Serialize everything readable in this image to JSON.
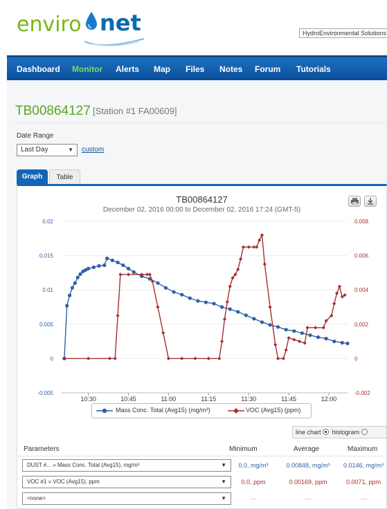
{
  "brand": {
    "logo_left": "enviro",
    "logo_right": "net",
    "tagline": "HydroEnvironmental Solutions"
  },
  "nav": {
    "items": [
      "Dashboard",
      "Monitor",
      "Alerts",
      "Map",
      "Files",
      "Notes",
      "Forum",
      "Tutorials"
    ],
    "active": "Monitor"
  },
  "station": {
    "id": "TB00864127",
    "sub": "[Station #1 FA00609]"
  },
  "date_range": {
    "label": "Date Range",
    "selected": "Last Day",
    "custom_link": "custom"
  },
  "tabs": {
    "graph": "Graph",
    "table": "Table"
  },
  "colors": {
    "series1": "#2f5fa8",
    "series2": "#a33030",
    "accent": "#1565b4",
    "station_title": "#5aa520"
  },
  "chart_data": {
    "type": "line",
    "title": "TB00864127",
    "subtitle": "December 02, 2016 00:00 to December 02, 2016 17:24 (GMT-5)",
    "x_ticks": [
      "10:30",
      "10:45",
      "11:00",
      "11:15",
      "11:30",
      "11:45",
      "12:00"
    ],
    "xlim": [
      "10:20",
      "12:07"
    ],
    "y_left": {
      "ticks": [
        "-0.005",
        "0",
        "0.005",
        "0.01",
        "0.015",
        "0.02"
      ],
      "range": [
        -0.005,
        0.02
      ]
    },
    "y_right": {
      "ticks": [
        "-0.002",
        "0",
        "0.002",
        "0.004",
        "0.006",
        "0.008"
      ],
      "range": [
        -0.002,
        0.008
      ]
    },
    "legend_placement": "bottom",
    "series": [
      {
        "name": "Mass Conc. Total (Avg15) (mg/m³)",
        "axis": "left",
        "marker": "circle",
        "points": [
          [
            "10:21",
            0.0
          ],
          [
            "10:22",
            0.0077
          ],
          [
            "10:23",
            0.0092
          ],
          [
            "10:24",
            0.0103
          ],
          [
            "10:25",
            0.011
          ],
          [
            "10:26",
            0.0118
          ],
          [
            "10:27",
            0.0123
          ],
          [
            "10:28",
            0.0127
          ],
          [
            "10:29",
            0.0129
          ],
          [
            "10:30",
            0.0131
          ],
          [
            "10:32",
            0.0133
          ],
          [
            "10:34",
            0.0135
          ],
          [
            "10:36",
            0.0136
          ],
          [
            "10:37",
            0.0146
          ],
          [
            "10:39",
            0.0143
          ],
          [
            "10:41",
            0.014
          ],
          [
            "10:43",
            0.0136
          ],
          [
            "10:45",
            0.0131
          ],
          [
            "10:47",
            0.0126
          ],
          [
            "10:50",
            0.012
          ],
          [
            "10:53",
            0.0116
          ],
          [
            "10:56",
            0.011
          ],
          [
            "10:59",
            0.0103
          ],
          [
            "11:02",
            0.0097
          ],
          [
            "11:05",
            0.0093
          ],
          [
            "11:08",
            0.0088
          ],
          [
            "11:11",
            0.0084
          ],
          [
            "11:14",
            0.0082
          ],
          [
            "11:17",
            0.008
          ],
          [
            "11:20",
            0.0075
          ],
          [
            "11:23",
            0.0072
          ],
          [
            "11:26",
            0.0068
          ],
          [
            "11:29",
            0.0063
          ],
          [
            "11:32",
            0.0058
          ],
          [
            "11:35",
            0.0053
          ],
          [
            "11:38",
            0.0049
          ],
          [
            "11:41",
            0.0046
          ],
          [
            "11:44",
            0.0042
          ],
          [
            "11:47",
            0.004
          ],
          [
            "11:50",
            0.0037
          ],
          [
            "11:53",
            0.0034
          ],
          [
            "11:56",
            0.0031
          ],
          [
            "11:59",
            0.0029
          ],
          [
            "12:02",
            0.0025
          ],
          [
            "12:05",
            0.0023
          ],
          [
            "12:07",
            0.0022
          ]
        ]
      },
      {
        "name": "VOC (Avg15) (ppm)",
        "axis": "right",
        "marker": "diamond",
        "points": [
          [
            "10:21",
            0.0
          ],
          [
            "10:30",
            0.0
          ],
          [
            "10:38",
            0.0
          ],
          [
            "10:40",
            0.0
          ],
          [
            "10:41",
            0.0025
          ],
          [
            "10:42",
            0.0049
          ],
          [
            "10:45",
            0.0049
          ],
          [
            "10:50",
            0.0049
          ],
          [
            "10:52",
            0.0049
          ],
          [
            "10:53",
            0.0049
          ],
          [
            "10:54",
            0.0045
          ],
          [
            "10:56",
            0.003
          ],
          [
            "10:58",
            0.0015
          ],
          [
            "11:00",
            0.0
          ],
          [
            "11:05",
            0.0
          ],
          [
            "11:10",
            0.0
          ],
          [
            "11:15",
            0.0
          ],
          [
            "11:19",
            0.0
          ],
          [
            "11:20",
            0.001
          ],
          [
            "11:21",
            0.0023
          ],
          [
            "11:22",
            0.0033
          ],
          [
            "11:23",
            0.0042
          ],
          [
            "11:24",
            0.0047
          ],
          [
            "11:25",
            0.0049
          ],
          [
            "11:26",
            0.0052
          ],
          [
            "11:27",
            0.0058
          ],
          [
            "11:28",
            0.0065
          ],
          [
            "11:30",
            0.0065
          ],
          [
            "11:32",
            0.0065
          ],
          [
            "11:33",
            0.0065
          ],
          [
            "11:34",
            0.0069
          ],
          [
            "11:35",
            0.0072
          ],
          [
            "11:36",
            0.0055
          ],
          [
            "11:38",
            0.003
          ],
          [
            "11:40",
            0.0008
          ],
          [
            "11:41",
            0.0
          ],
          [
            "11:43",
            0.0
          ],
          [
            "11:44",
            0.0005
          ],
          [
            "11:45",
            0.0012
          ],
          [
            "11:47",
            0.0011
          ],
          [
            "11:49",
            0.001
          ],
          [
            "11:51",
            0.0009
          ],
          [
            "11:52",
            0.0018
          ],
          [
            "11:55",
            0.0018
          ],
          [
            "11:58",
            0.0018
          ],
          [
            "11:59",
            0.0022
          ],
          [
            "12:01",
            0.0025
          ],
          [
            "12:02",
            0.0032
          ],
          [
            "12:03",
            0.0038
          ],
          [
            "12:04",
            0.0042
          ],
          [
            "12:05",
            0.0036
          ],
          [
            "12:06",
            0.0037
          ]
        ]
      }
    ]
  },
  "view_toggle": {
    "line": "line chart",
    "hist": "histogram"
  },
  "parameters": {
    "headers": {
      "name": "Parameters",
      "min": "Minimum",
      "avg": "Average",
      "max": "Maximum"
    },
    "rows": [
      {
        "name": "DUST #... » Mass Conc. Total (Avg15), mg/m³",
        "min": "0.0, mg/m³",
        "avg": "0.00848, mg/m³",
        "max": "0.0146, mg/m³",
        "color": "#2f5fa8"
      },
      {
        "name": "VOC #1 » VOC (Avg15), ppm",
        "min": "0.0, ppm",
        "avg": "0.00169, ppm",
        "max": "0.0071, ppm",
        "color": "#a33030"
      },
      {
        "name": "<none>",
        "min": "—",
        "avg": "—",
        "max": "—",
        "color": "#bbbbbb"
      }
    ]
  }
}
